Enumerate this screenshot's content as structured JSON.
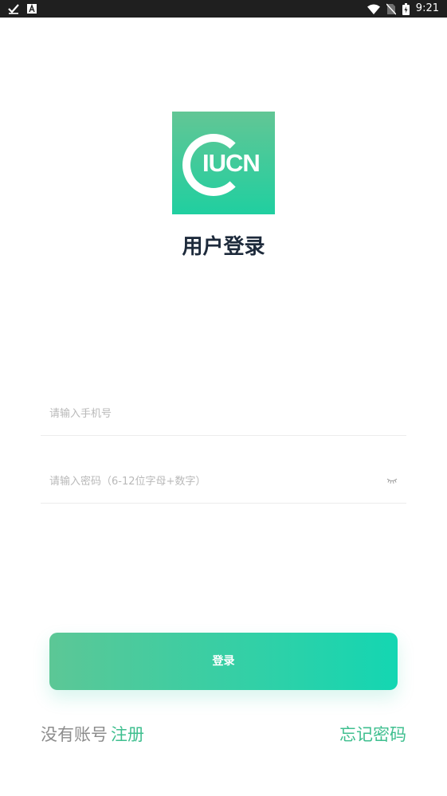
{
  "status_bar": {
    "time": "9:21",
    "left_icons": [
      "check-icon",
      "a-icon"
    ],
    "right_icons": [
      "wifi-icon",
      "no-sim-icon",
      "battery-icon"
    ]
  },
  "logo": {
    "text": "IUCN"
  },
  "page": {
    "title": "用户登录"
  },
  "form": {
    "phone_placeholder": "请输入手机号",
    "password_placeholder": "请输入密码（6-12位字母+数字）",
    "login_label": "登录"
  },
  "footer": {
    "no_account": "没有账号",
    "register": "注册",
    "forgot": "忘记密码"
  },
  "colors": {
    "accent": "#3fbf8f",
    "button_start": "#5cc796",
    "button_end": "#14d6b2",
    "title": "#1d2a3b",
    "status_bar": "#1f1f1f"
  }
}
